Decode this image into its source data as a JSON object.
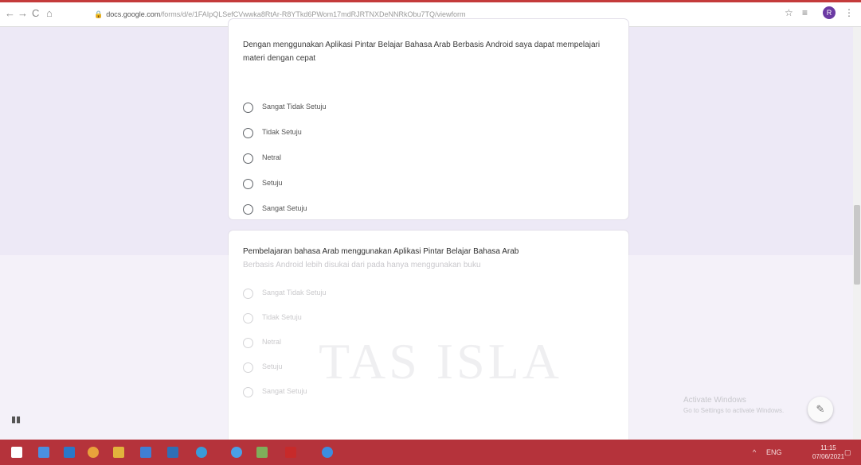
{
  "browser": {
    "url_host": "docs.google.com",
    "url_path": "/forms/d/e/1FAIpQLSefCVwwka8RtAr-R8YTkd6PWom17mdRJRTNXDeNNRkObu7TQ/viewform",
    "nav_icons": [
      "back-icon",
      "forward-icon",
      "reload-icon",
      "home-icon"
    ],
    "profile_initial": "R"
  },
  "form": {
    "question1": {
      "text": "Dengan menggunakan Aplikasi Pintar Belajar Bahasa Arab Berbasis Android saya dapat mempelajari materi dengan cepat",
      "options": [
        "Sangat Tidak Setuju",
        "Tidak Setuju",
        "Netral",
        "Setuju",
        "Sangat Setuju"
      ]
    },
    "question2": {
      "text_line1": "Pembelajaran bahasa Arab menggunakan Aplikasi Pintar Belajar Bahasa Arab",
      "text_line2": "Berbasis Android lebih disukai dari pada hanya menggunakan buku",
      "options": [
        "Sangat Tidak Setuju",
        "Tidak Setuju",
        "Netral",
        "Setuju",
        "Sangat Setuju"
      ]
    }
  },
  "overlay": {
    "watermark": "TAS ISLA",
    "activate_title": "Activate Windows",
    "activate_sub": "Go to Settings to activate Windows."
  },
  "taskbar": {
    "tray_text": "ENG",
    "time": "11:15",
    "date": "07/06/2021"
  },
  "colors": {
    "taskbar": "#b5333b",
    "page_bg": "#ede9f6",
    "profile": "#6b3aa3"
  }
}
